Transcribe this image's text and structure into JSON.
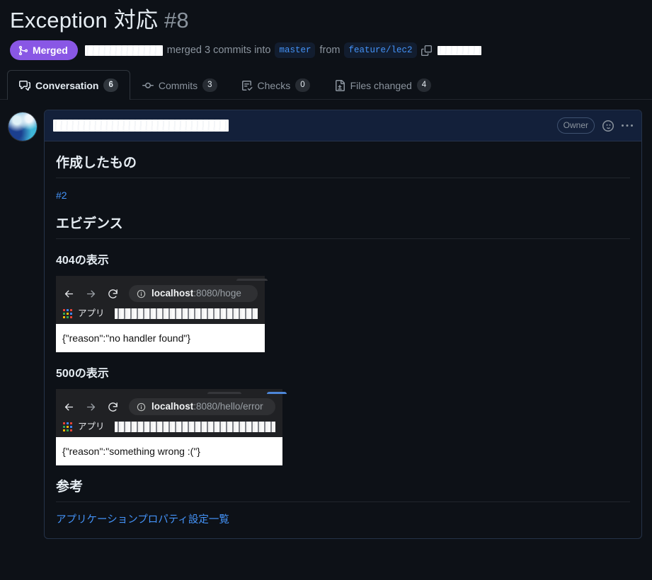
{
  "pr": {
    "title": "Exception 対応",
    "number": "#8",
    "state_label": "Merged",
    "state_color": "#8957e5",
    "merged_text": "merged 3 commits into",
    "from_text": "from",
    "base_branch": "master",
    "head_branch": "feature/lec2"
  },
  "tabs": [
    {
      "label": "Conversation",
      "count": "6",
      "icon": "comment-discussion-icon",
      "active": true
    },
    {
      "label": "Commits",
      "count": "3",
      "icon": "git-commit-icon",
      "active": false
    },
    {
      "label": "Checks",
      "count": "0",
      "icon": "checklist-icon",
      "active": false
    },
    {
      "label": "Files changed",
      "count": "4",
      "icon": "file-diff-icon",
      "active": false
    }
  ],
  "comment": {
    "author_role_badge": "Owner",
    "reaction_icon": "smiley-icon",
    "menu_icon": "kebab-horizontal-icon",
    "sections": {
      "created_heading": "作成したもの",
      "issue_link": "#2",
      "evidence_heading": "エビデンス",
      "shot404_heading": "404の表示",
      "shot500_heading": "500の表示",
      "reference_heading": "参考",
      "reference_link": "アプリケーションプロパティ設定一覧"
    }
  },
  "screenshots": [
    {
      "name": "404-screenshot",
      "url_host": "localhost",
      "url_path": ":8080/hoge",
      "bookmark_label": "アプリ",
      "response_body": "{\"reason\":\"no handler found\"}"
    },
    {
      "name": "500-screenshot",
      "url_host": "localhost",
      "url_path": ":8080/hello/error",
      "bookmark_label": "アプリ",
      "response_body": "{\"reason\":\"something wrong :(\"}"
    }
  ],
  "colors": {
    "page_bg": "#0d1117",
    "link": "#4493f8",
    "merged_purple": "#8957e5",
    "comment_header_bg": "#13203a",
    "border": "#253349"
  }
}
